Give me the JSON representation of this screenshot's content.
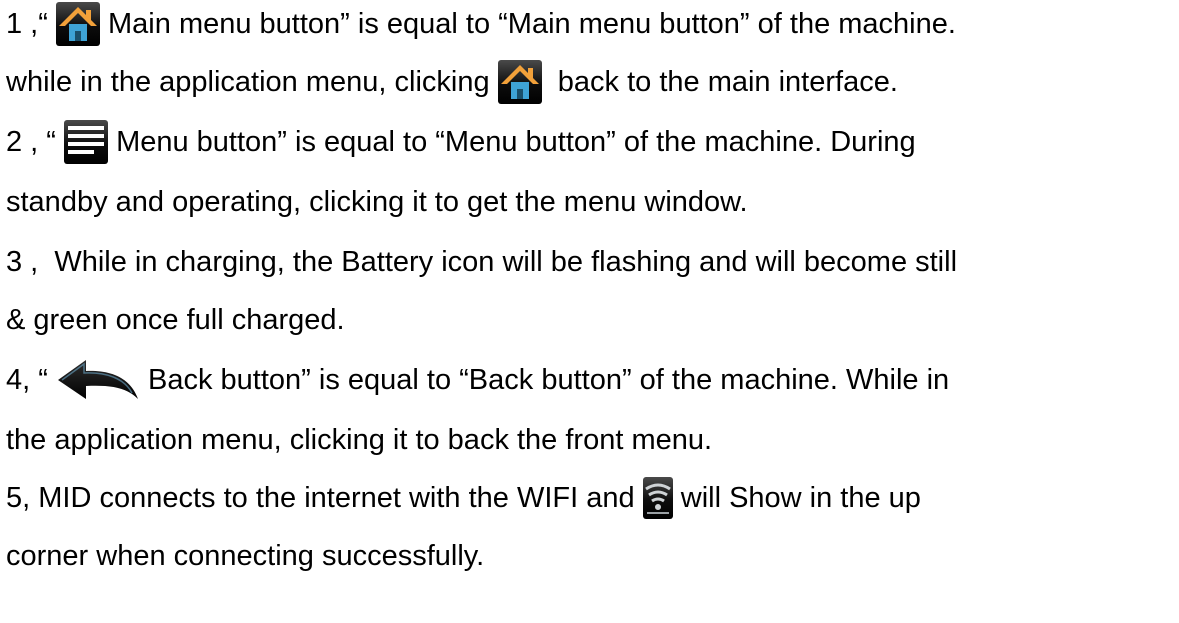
{
  "items": [
    {
      "prefix": "1 ,“ ",
      "icon": "home-icon",
      "text": " Main menu button” is equal to “Main menu button” of the machine."
    },
    {
      "prefix": "while in the application menu, clicking ",
      "icon": "home-icon",
      "text": "  back to the main interface."
    },
    {
      "prefix": "2 , “ ",
      "icon": "menu-icon",
      "text": " Menu button” is equal to “Menu button” of the machine. During"
    },
    {
      "text": "standby and operating, clicking it to get the menu window."
    },
    {
      "text": "3 ,  While in charging, the Battery icon will be flashing and will become still"
    },
    {
      "text": "& green once full charged."
    },
    {
      "prefix": "4, “ ",
      "icon": "back-arrow-icon",
      "text": " Back button” is equal to “Back button” of the machine. While in"
    },
    {
      "text": "the application menu, clicking it to back the front menu."
    },
    {
      "prefix": "5, MID connects to the internet with the WIFI and ",
      "icon": "wifi-icon",
      "text": " will Show in the up"
    },
    {
      "text": "corner when connecting successfully."
    }
  ],
  "colors": {
    "icon_background": "#000000",
    "home_roof": "#f2a13a",
    "home_body": "#3ea3d6",
    "menu_lines": "#ffffff",
    "wifi_lines": "#cfd3d6"
  }
}
